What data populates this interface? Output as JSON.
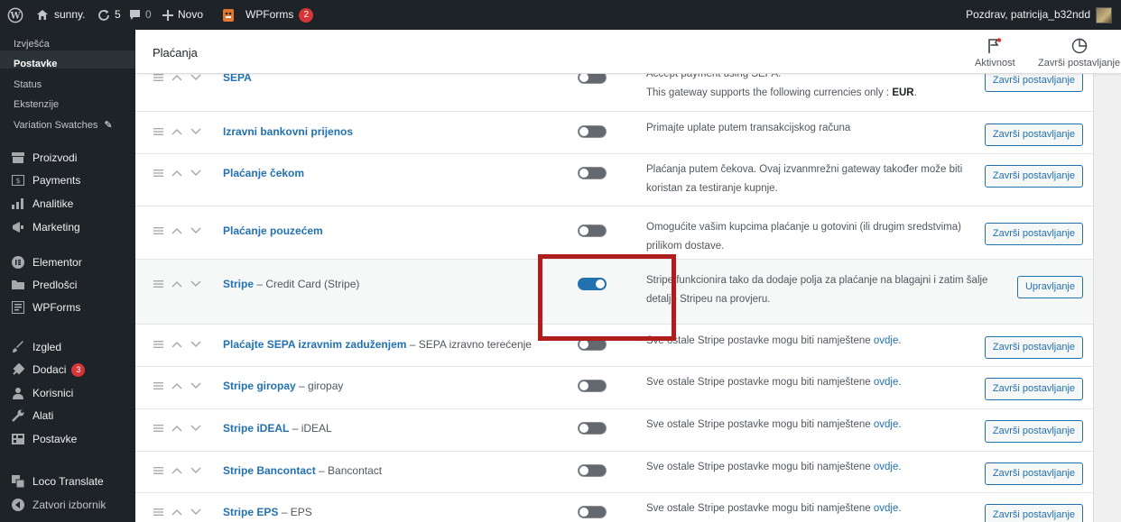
{
  "adminbar": {
    "site_name": "sunny.",
    "updates_count": "5",
    "comments_count": "0",
    "new_label": "Novo",
    "wpforms_label": "WPForms",
    "wpforms_badge": "2",
    "greeting": "Pozdrav, patricija_b32ndd"
  },
  "sidebar": {
    "submenu": [
      "Izvješća",
      "Postavke",
      "Status",
      "Ekstenzije",
      "Variation Swatches"
    ],
    "items": [
      {
        "label": "Proizvodi",
        "icon": "archive-icon"
      },
      {
        "label": "Payments",
        "icon": "payments-icon"
      },
      {
        "label": "Analitike",
        "icon": "bar-chart-icon"
      },
      {
        "label": "Marketing",
        "icon": "megaphone-icon"
      },
      {
        "label": "Elementor",
        "icon": "elementor-icon"
      },
      {
        "label": "Predlošci",
        "icon": "folder-icon"
      },
      {
        "label": "WPForms",
        "icon": "form-icon"
      },
      {
        "label": "Izgled",
        "icon": "paintbrush-icon"
      },
      {
        "label": "Dodaci",
        "icon": "plugin-icon",
        "badge": "3"
      },
      {
        "label": "Korisnici",
        "icon": "users-icon"
      },
      {
        "label": "Alati",
        "icon": "wrench-icon"
      },
      {
        "label": "Postavke",
        "icon": "settings-icon"
      },
      {
        "label": "Loco Translate",
        "icon": "translate-icon"
      },
      {
        "label": "Zatvori izbornik",
        "icon": "collapse-icon"
      }
    ]
  },
  "header": {
    "title": "Plaćanja",
    "activity_label": "Aktivnost",
    "finish_setup_label": "Završi postavljanje"
  },
  "gateways": [
    {
      "name": "SEPA",
      "suffix": "",
      "enabled": false,
      "description": "Accept payment using SEPA.",
      "description2": "This gateway supports the following currencies only : ",
      "currency": "EUR",
      "action": "Završi postavljanje"
    },
    {
      "name": "Izravni bankovni prijenos",
      "suffix": "",
      "enabled": false,
      "description": "Primajte uplate putem transakcijskog računa",
      "action": "Završi postavljanje"
    },
    {
      "name": "Plaćanje čekom",
      "suffix": "",
      "enabled": false,
      "description": "Plaćanja putem čekova. Ovaj izvanmrežni gateway također može biti koristan za testiranje kupnje.",
      "action": "Završi postavljanje"
    },
    {
      "name": "Plaćanje pouzećem",
      "suffix": "",
      "enabled": false,
      "description": "Omogućite vašim kupcima plaćanje u gotovini (ili drugim sredstvima) prilikom dostave.",
      "action": "Završi postavljanje"
    },
    {
      "name": "Stripe",
      "suffix": "– Credit Card (Stripe)",
      "enabled": true,
      "description": "Stripe funkcionira tako da dodaje polja za plaćanje na blagajni i zatim šalje detalje Stripeu na provjeru.",
      "action": "Upravljanje"
    },
    {
      "name": "Plaćajte SEPA izravnim zaduženjem",
      "suffix": "– SEPA izravno terećenje",
      "enabled": false,
      "description": "Sve ostale Stripe postavke mogu biti namještene ",
      "link": "ovdje",
      "action": "Završi postavljanje"
    },
    {
      "name": "Stripe giropay",
      "suffix": "– giropay",
      "enabled": false,
      "description": "Sve ostale Stripe postavke mogu biti namještene ",
      "link": "ovdje",
      "action": "Završi postavljanje"
    },
    {
      "name": "Stripe iDEAL",
      "suffix": "– iDEAL",
      "enabled": false,
      "description": "Sve ostale Stripe postavke mogu biti namještene ",
      "link": "ovdje",
      "action": "Završi postavljanje"
    },
    {
      "name": "Stripe Bancontact",
      "suffix": "– Bancontact",
      "enabled": false,
      "description": "Sve ostale Stripe postavke mogu biti namještene ",
      "link": "ovdje",
      "action": "Završi postavljanje"
    },
    {
      "name": "Stripe EPS",
      "suffix": "– EPS",
      "enabled": false,
      "description": "Sve ostale Stripe postavke mogu biti namještene ",
      "link": "ovdje",
      "action": "Završi postavljanje"
    }
  ],
  "colors": {
    "admin_dark": "#1d2327",
    "link_blue": "#2271b1",
    "toggle_on": "#2271b1",
    "toggle_off": "#646970",
    "badge_red": "#d63638",
    "highlight_red": "#b01d1d"
  }
}
